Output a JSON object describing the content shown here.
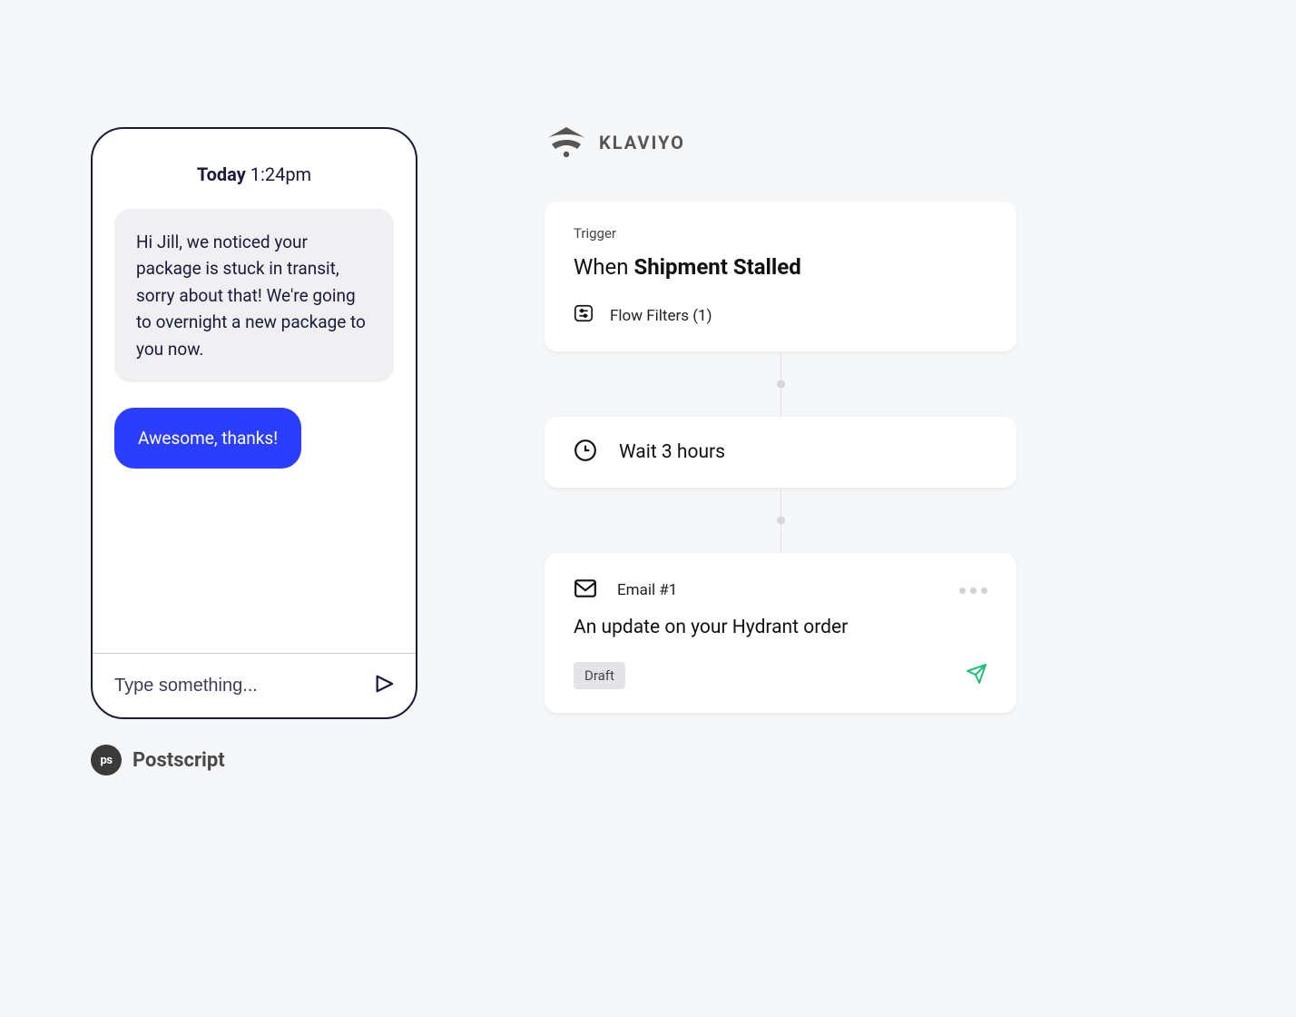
{
  "chat": {
    "day_label": "Today",
    "time_label": "1:24pm",
    "incoming_msg": "Hi Jill, we noticed your package is stuck in transit, sorry about that! We're going to overnight a new package to you now.",
    "outgoing_msg": "Awesome, thanks!",
    "input_placeholder": "Type something..."
  },
  "postscript": {
    "badge": "ps",
    "name": "Postscript"
  },
  "klaviyo": {
    "name": "KLAVIYO",
    "trigger_label": "Trigger",
    "trigger_prefix": "When ",
    "trigger_event": "Shipment Stalled",
    "filters_label": "Flow Filters (1)",
    "wait_label": "Wait 3 hours",
    "email_label": "Email #1",
    "email_subject": "An update on your Hydrant order",
    "draft_label": "Draft"
  }
}
